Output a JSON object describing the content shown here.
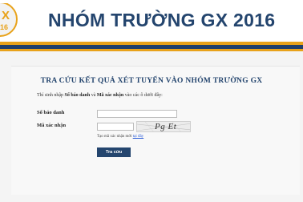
{
  "header": {
    "logo_text_top": "X",
    "logo_text_bottom": "16",
    "title": "NHÓM TRƯỜNG GX 2016"
  },
  "form": {
    "title": "TRA CỨU KẾT QUẢ XÉT TUYỂN VÀO NHÓM TRƯỜNG GX",
    "instruction_prefix": "Thí sinh nhập ",
    "instruction_field1": "Số báo danh",
    "instruction_mid": " và ",
    "instruction_field2": "Mã xác nhận",
    "instruction_suffix": " vào các ô dưới đây:",
    "sbd_label": "Số báo danh",
    "sbd_value": "",
    "captcha_label": "Mã xác nhận",
    "captcha_value": "",
    "captcha_text": "Pg Et",
    "refresh_prefix": "Tạo mã xác nhận mới ",
    "refresh_link": "tại đây",
    "submit_label": "Tra cứu"
  },
  "colors": {
    "brand_navy": "#24456e",
    "brand_orange": "#e8a21a"
  }
}
